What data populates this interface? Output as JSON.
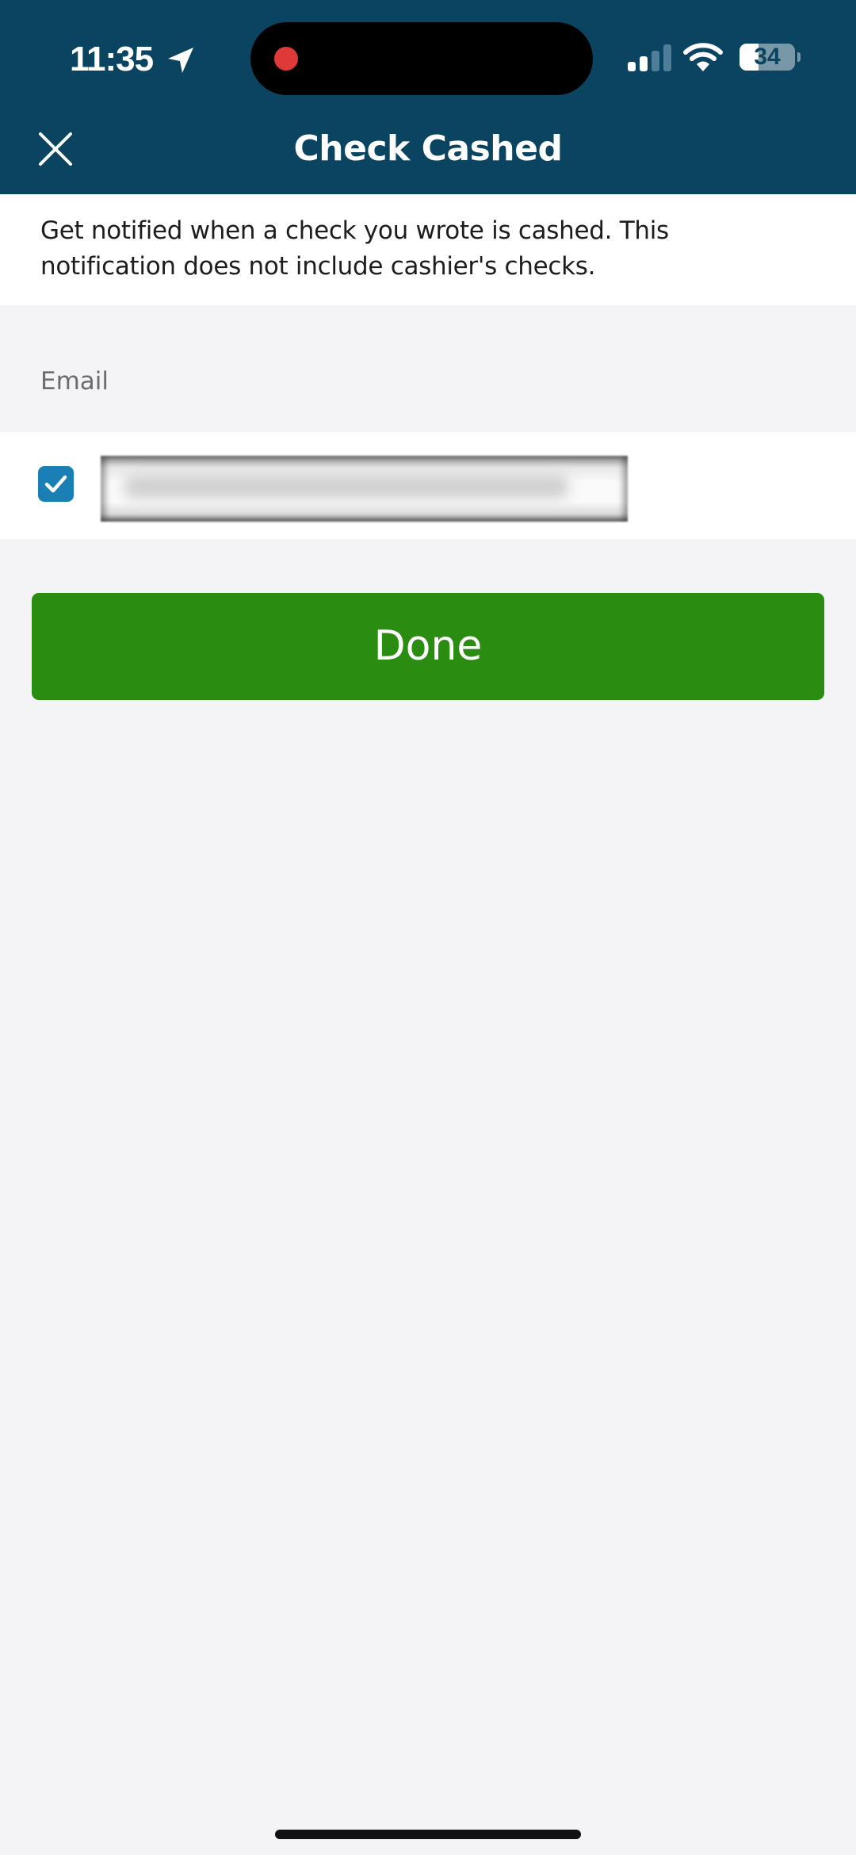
{
  "status_bar": {
    "time": "11:35",
    "battery_level": "34",
    "battery_fraction": 0.34,
    "signal_bars_active": 2,
    "signal_bars_total": 4,
    "recording_indicator_color": "#e0393a"
  },
  "header": {
    "title": "Check Cashed",
    "close_icon": "close-icon",
    "background_color": "#0b4460"
  },
  "description": {
    "text": "Get notified when a check you wrote is cashed. This notification does not include cashier's checks."
  },
  "email_section": {
    "label": "Email",
    "items": [
      {
        "checked": true,
        "value": "[redacted email address]",
        "checkbox_color": "#1a7fb5"
      }
    ]
  },
  "actions": {
    "done_label": "Done",
    "done_color": "#2b8c12"
  }
}
